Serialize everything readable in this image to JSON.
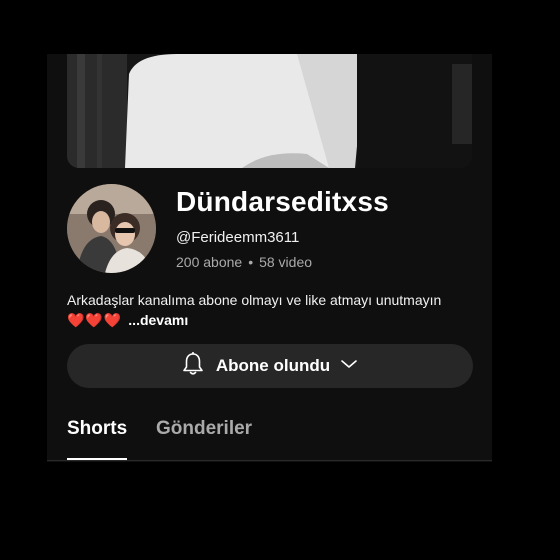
{
  "channel": {
    "name": "Dündarseditxss",
    "handle": "@Ferideemm3611",
    "subscribers": "200 abone",
    "separator": "•",
    "videos": "58 video",
    "description_line1": "Arkadaşlar kanalıma abone olmayı ve like atmayı unutmayın",
    "hearts": "❤️❤️❤️",
    "more_label": "...devamı"
  },
  "subscribe_button": {
    "label": "Abone olundu",
    "bell_icon": "bell-icon",
    "chevron_icon": "chevron-down-icon"
  },
  "tabs": [
    {
      "label": "Shorts",
      "active": true
    },
    {
      "label": "Gönderiler",
      "active": false
    }
  ],
  "colors": {
    "background": "#0f0f0f",
    "button_bg": "#272727",
    "secondary_text": "#aaaaaa"
  }
}
